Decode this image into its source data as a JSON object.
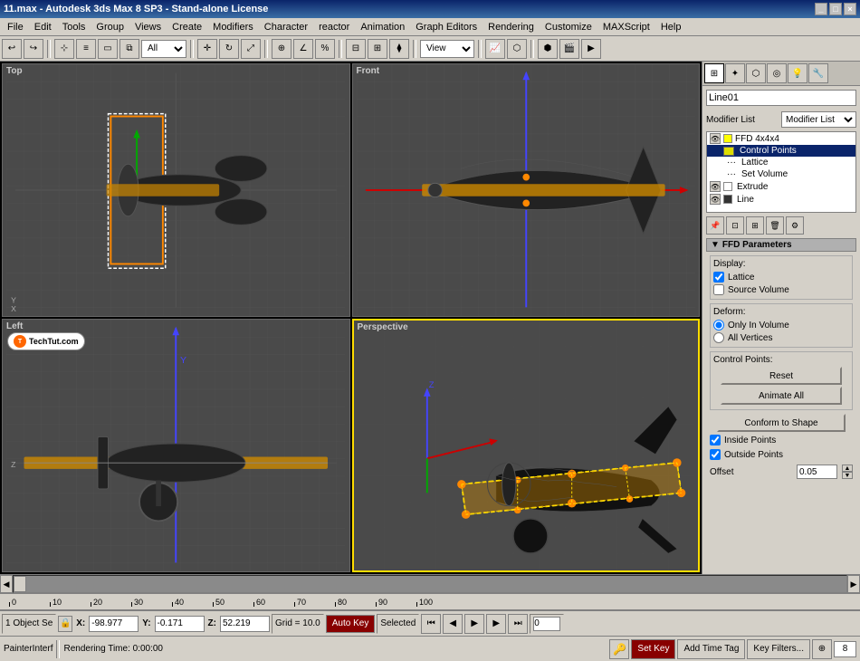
{
  "window": {
    "title": "11.max - Autodesk 3ds Max 8 SP3 - Stand-alone License",
    "controls": [
      "_",
      "□",
      "×"
    ]
  },
  "menubar": {
    "items": [
      "File",
      "Edit",
      "Tools",
      "Group",
      "Views",
      "Create",
      "Modifiers",
      "Character",
      "reactor",
      "Animation",
      "Graph Editors",
      "Rendering",
      "Customize",
      "MAXScript",
      "Help"
    ]
  },
  "toolbar": {
    "dropdown_all": "All",
    "dropdown_view": "View"
  },
  "viewports": [
    {
      "label": "Top",
      "active": false
    },
    {
      "label": "Front",
      "active": false
    },
    {
      "label": "Left",
      "active": false
    },
    {
      "label": "Perspective",
      "active": true
    }
  ],
  "right_panel": {
    "object_name": "Line01",
    "modifier_list_label": "Modifier List",
    "modifiers": [
      {
        "name": "FFD 4x4x4",
        "indent": 0,
        "selected": false,
        "has_eye": true,
        "color": "#ffff00"
      },
      {
        "name": "Control Points",
        "indent": 1,
        "selected": true,
        "has_eye": false,
        "color": "#dddd00"
      },
      {
        "name": "Lattice",
        "indent": 1,
        "selected": false,
        "has_eye": false,
        "color": null
      },
      {
        "name": "Set Volume",
        "indent": 1,
        "selected": false,
        "has_eye": false,
        "color": null
      },
      {
        "name": "Extrude",
        "indent": 0,
        "selected": false,
        "has_eye": true,
        "color": null
      },
      {
        "name": "Line",
        "indent": 0,
        "selected": false,
        "has_eye": true,
        "color": "#333333"
      }
    ],
    "sections": {
      "ffd_parameters": {
        "title": "FFD Parameters",
        "display": {
          "label": "Display:",
          "lattice_checked": true,
          "lattice_label": "Lattice",
          "source_volume_checked": false,
          "source_volume_label": "Source Volume"
        },
        "deform": {
          "label": "Deform:",
          "only_in_volume_checked": true,
          "only_in_volume_label": "Only In Volume",
          "all_vertices_checked": false,
          "all_vertices_label": "All Vertices"
        },
        "control_points": {
          "label": "Control Points:",
          "reset_label": "Reset",
          "animate_all_label": "Animate All"
        },
        "conform_label": "Conform to Shape",
        "inside_points_checked": true,
        "inside_points_label": "Inside Points",
        "outside_points_checked": true,
        "outside_points_label": "Outside Points",
        "offset_label": "Offset",
        "offset_value": "0.05"
      }
    }
  },
  "timeline": {
    "current": "0 / 100",
    "marks": [
      "0",
      "10",
      "20",
      "30",
      "40",
      "50",
      "60",
      "70",
      "80",
      "90",
      "100"
    ]
  },
  "status_bar": {
    "object_status": "1 Object Se",
    "x_label": "X:",
    "x_value": "-98.977",
    "y_label": "Y:",
    "y_value": "-0.171",
    "z_label": "Z:",
    "z_value": "52.219",
    "grid_label": "Grid = 10.0",
    "auto_key_label": "Auto Key",
    "selected_label": "Selected",
    "set_key_label": "Set Key",
    "key_filters_label": "Key Filters..."
  },
  "bottom_bar": {
    "painter_label": "PainterInterf",
    "rendering_label": "Rendering Time: 0:00:00",
    "add_time_tag_label": "Add Time Tag"
  }
}
